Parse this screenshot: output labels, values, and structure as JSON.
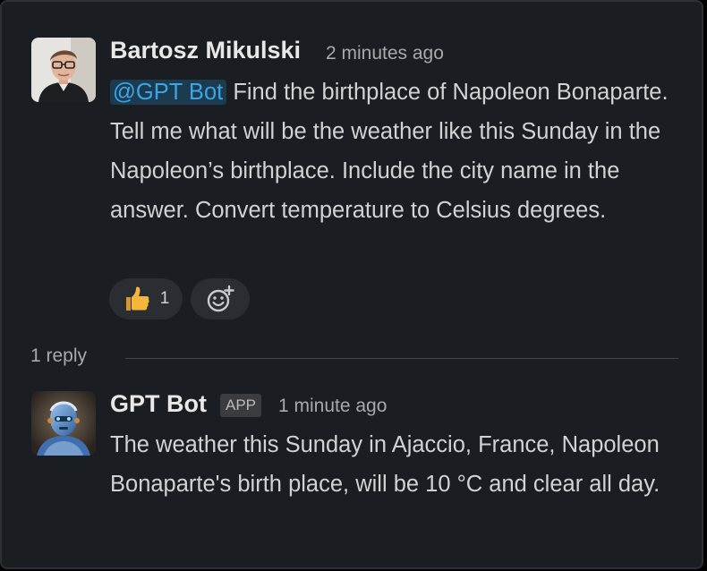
{
  "message": {
    "author": "Bartosz Mikulski",
    "time": "2 minutes ago",
    "mention": "@GPT Bot",
    "text": "Find the birthplace of Napoleon Bonaparte. Tell me what will be the weather like this Sunday in the Napoleon’s birthplace. Include the city name in the answer. Convert temperature to Celsius degrees.",
    "reaction": {
      "emoji": "thumbs-up-icon",
      "count": "1"
    },
    "add_reaction_icon": "add-emoji-icon"
  },
  "thread": {
    "replies_label": "1 reply"
  },
  "reply": {
    "author": "GPT Bot",
    "badge": "APP",
    "time": "1 minute ago",
    "text": "The weather this Sunday in Ajaccio, France, Napoleon Bonaparte's birth place, will be 10 °C and clear all day."
  },
  "colors": {
    "background": "#1a1d21",
    "mention_bg": "#1c3b4e",
    "mention_text": "#3aa6e8",
    "thumbs_up": "#f4b73a"
  }
}
